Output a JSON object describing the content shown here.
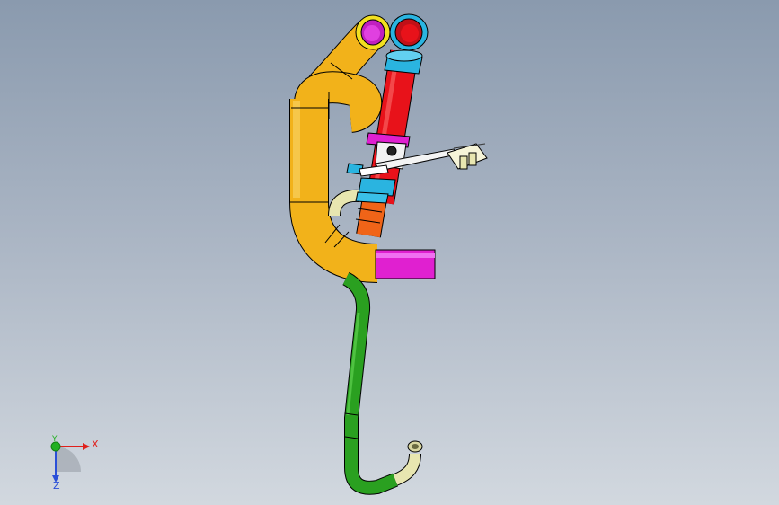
{
  "viewport": {
    "name": "3d-graphics-area"
  },
  "triad": {
    "x_label": "X",
    "y_label": "Y",
    "z_label": "Z",
    "x_color": "#e0201c",
    "y_color": "#22b022",
    "z_color": "#2a4fd8"
  },
  "parts": {
    "orange_hose_color": "#f2b21a",
    "red_pipe_color": "#e8121a",
    "cyan_fitting_color": "#2ab4e0",
    "magenta_sleeve_color": "#e020d0",
    "green_line_color": "#2aa020",
    "beige_fitting_color": "#e8e6b0",
    "orange_adapter_color": "#f06418"
  }
}
